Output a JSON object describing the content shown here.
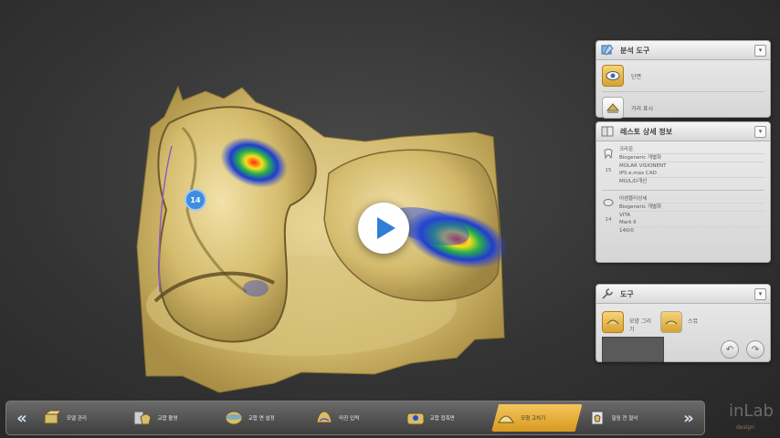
{
  "viewport": {
    "tooth_number": "14"
  },
  "panels": {
    "analysis": {
      "title": "분석 도구",
      "items": [
        {
          "label": "단면",
          "icon": "section-eye-icon",
          "active": true
        },
        {
          "label": "거리 표시",
          "icon": "distance-icon",
          "active": false
        }
      ]
    },
    "restoration": {
      "title": "레스토 상세 정보",
      "blocks": [
        {
          "num": "15",
          "lines": [
            "크라운",
            "Biogeneric 개별화",
            "MOLAR VISIONENT",
            "IPS e.max CAD",
            "MO/L/D개선"
          ]
        },
        {
          "num": "14",
          "lines": [
            "어셈블리상세",
            "Biogeneric 개별화",
            "VITA",
            "Mark II",
            "140/0"
          ]
        }
      ]
    },
    "tools": {
      "title": "도구",
      "items": [
        {
          "label": "모양 그리기",
          "icon": "shape-tool-icon",
          "active": true
        },
        {
          "label": "스뮤",
          "icon": "smooth-tool-icon",
          "active": false
        }
      ]
    }
  },
  "bottom_bar": {
    "prev": "«",
    "next": "»",
    "steps": [
      {
        "label": "모델 관리",
        "active": false
      },
      {
        "label": "교합 촬영",
        "active": false
      },
      {
        "label": "교합 면 설정",
        "active": false
      },
      {
        "label": "마진 입력",
        "active": false
      },
      {
        "label": "교합 접촉면",
        "active": false
      },
      {
        "label": "모형 고치기",
        "active": true
      },
      {
        "label": "밀링 전 절삭",
        "active": false
      }
    ]
  },
  "logo": {
    "text": "inLab",
    "sub": "design"
  },
  "colors": {
    "accent": "#f0b840",
    "model": "#d8c27a",
    "contact_blue": "#2a4ad8",
    "contact_red": "#e02a10"
  }
}
